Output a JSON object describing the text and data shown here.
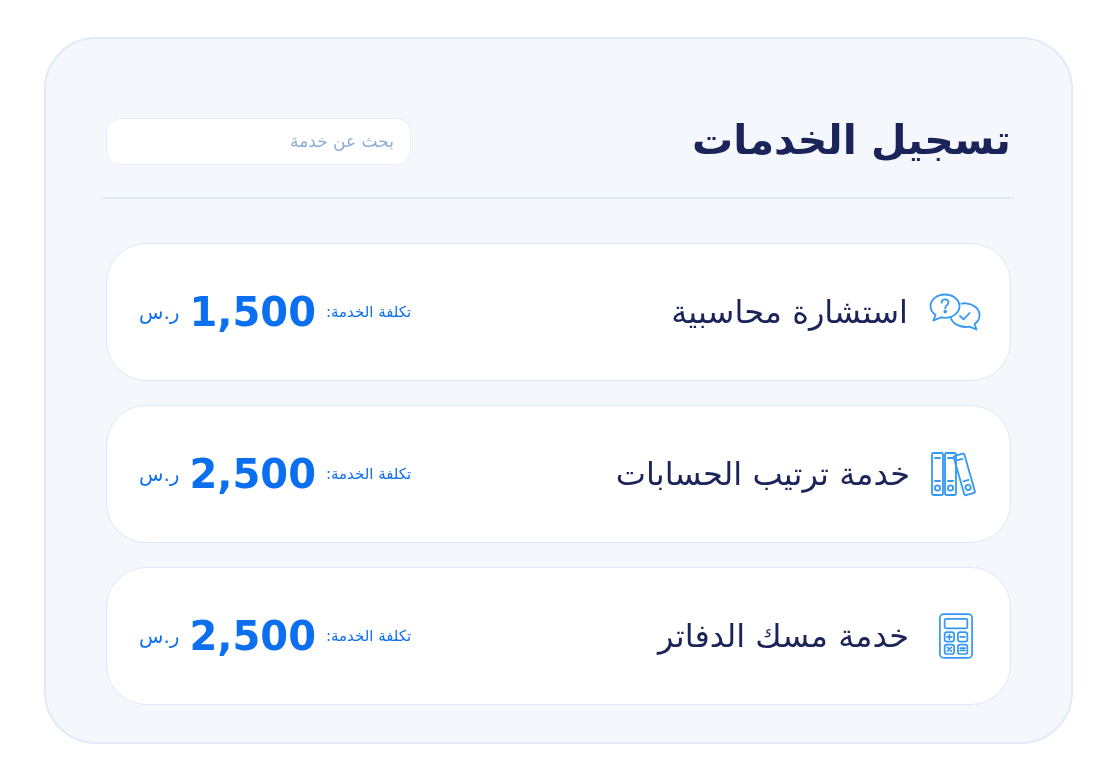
{
  "page": {
    "title": "تسجيل الخدمات",
    "search": {
      "placeholder": "بحث عن خدمة"
    }
  },
  "services": [
    {
      "kind": "chat",
      "name": "استشارة محاسبية",
      "cost_label": "تكلفة الخدمة:",
      "price": "1,500",
      "currency": "ر.س"
    },
    {
      "kind": "binders",
      "name": "خدمة ترتيب الحسابات",
      "cost_label": "تكلفة الخدمة:",
      "price": "2,500",
      "currency": "ر.س"
    },
    {
      "kind": "calculator",
      "name": "خدمة مسك الدفاتر",
      "cost_label": "تكلفة الخدمة:",
      "price": "2,500",
      "currency": "ر.س"
    }
  ]
}
